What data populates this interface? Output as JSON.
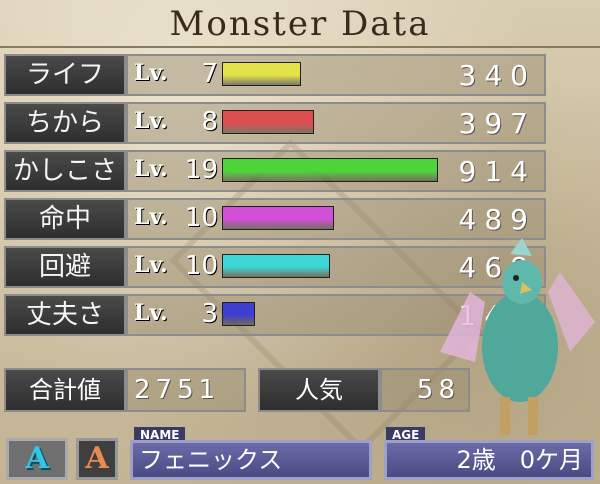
{
  "title": "Monster Data",
  "stats": [
    {
      "label": "ライフ",
      "lv_prefix": "Lv.",
      "level": "7",
      "value": "340",
      "bar_fraction": 0.36,
      "bar_color": "#e3e247"
    },
    {
      "label": "ちから",
      "lv_prefix": "Lv.",
      "level": "8",
      "value": "397",
      "bar_fraction": 0.42,
      "bar_color": "#dd4f4f"
    },
    {
      "label": "かしこさ",
      "lv_prefix": "Lv.",
      "level": "19",
      "value": "914",
      "bar_fraction": 0.98,
      "bar_color": "#4fd33b"
    },
    {
      "label": "命中",
      "lv_prefix": "Lv.",
      "level": "10",
      "value": "489",
      "bar_fraction": 0.51,
      "bar_color": "#d24fd8"
    },
    {
      "label": "回避",
      "lv_prefix": "Lv.",
      "level": "10",
      "value": "468",
      "bar_fraction": 0.49,
      "bar_color": "#3ed6d6"
    },
    {
      "label": "丈夫さ",
      "lv_prefix": "Lv.",
      "level": "3",
      "value": "143",
      "bar_fraction": 0.15,
      "bar_color": "#3e3ecf"
    }
  ],
  "total": {
    "label": "合計値",
    "value": "2751"
  },
  "popularity": {
    "label": "人気",
    "value": "58"
  },
  "buttons": {
    "a_cyan": "A",
    "a_orange": "A"
  },
  "name": {
    "tag": "NAME",
    "value": "フェニックス"
  },
  "age": {
    "tag": "AGE",
    "value": "2歳　0ケ月"
  }
}
